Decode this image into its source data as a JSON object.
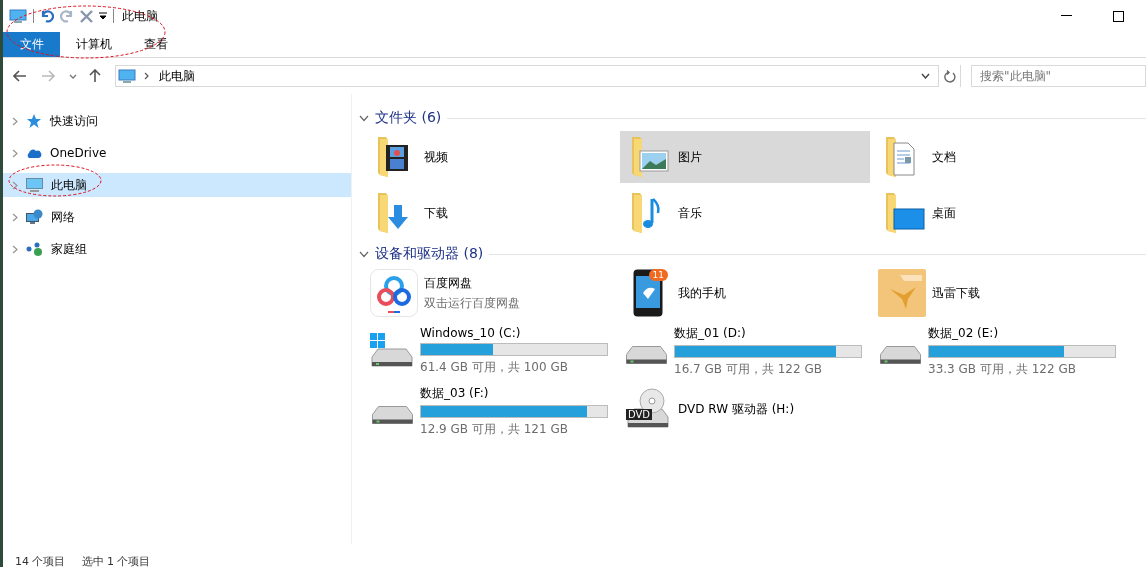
{
  "window": {
    "title": "此电脑"
  },
  "ribbon_tabs": [
    {
      "label": "文件",
      "kind": "file"
    },
    {
      "label": "计算机",
      "kind": "tab"
    },
    {
      "label": "查看",
      "kind": "tab"
    }
  ],
  "address_bar": {
    "path": "此电脑"
  },
  "search": {
    "placeholder": "搜索\"此电脑\""
  },
  "nav_items": [
    {
      "label": "快速访问",
      "kind": "quick",
      "selected": false
    },
    {
      "label": "OneDrive",
      "kind": "cloud",
      "selected": false
    },
    {
      "label": "此电脑",
      "kind": "pc",
      "selected": true
    },
    {
      "label": "网络",
      "kind": "network",
      "selected": false
    },
    {
      "label": "家庭组",
      "kind": "homegroup",
      "selected": false
    }
  ],
  "sections": [
    {
      "title": "文件夹 (6)",
      "expanded": true,
      "items": [
        {
          "kind": "video",
          "label": "视频",
          "selected": false
        },
        {
          "kind": "pictures",
          "label": "图片",
          "selected": true
        },
        {
          "kind": "documents",
          "label": "文档",
          "selected": false
        },
        {
          "kind": "downloads",
          "label": "下载",
          "selected": false
        },
        {
          "kind": "music",
          "label": "音乐",
          "selected": false
        },
        {
          "kind": "desktop",
          "label": "桌面",
          "selected": false
        }
      ]
    },
    {
      "title": "设备和驱动器 (8)",
      "expanded": true,
      "items": [
        {
          "kind": "cloud_app",
          "label": "百度网盘",
          "subtitle": "双击运行百度网盘"
        },
        {
          "kind": "phone",
          "label": "我的手机",
          "badge": "11"
        },
        {
          "kind": "app_folder",
          "label": "迅雷下载"
        },
        {
          "kind": "system_drive",
          "label": "Windows_10 (C:)",
          "level": 0.386,
          "reading": "61.4 GB 可用，共 100 GB"
        },
        {
          "kind": "drive",
          "label": "数据_01 (D:)",
          "level": 0.863,
          "reading": "16.7 GB 可用，共 122 GB"
        },
        {
          "kind": "drive",
          "label": "数据_02 (E:)",
          "level": 0.727,
          "reading": "33.3 GB 可用，共 122 GB"
        },
        {
          "kind": "drive",
          "label": "数据_03 (F:)",
          "level": 0.893,
          "reading": "12.9 GB 可用，共 121 GB"
        },
        {
          "kind": "dvd",
          "label": "DVD RW 驱动器 (H:)",
          "badge": "DVD"
        }
      ]
    }
  ],
  "status_bar": [
    "14 个项目",
    "选中 1 个项目"
  ]
}
